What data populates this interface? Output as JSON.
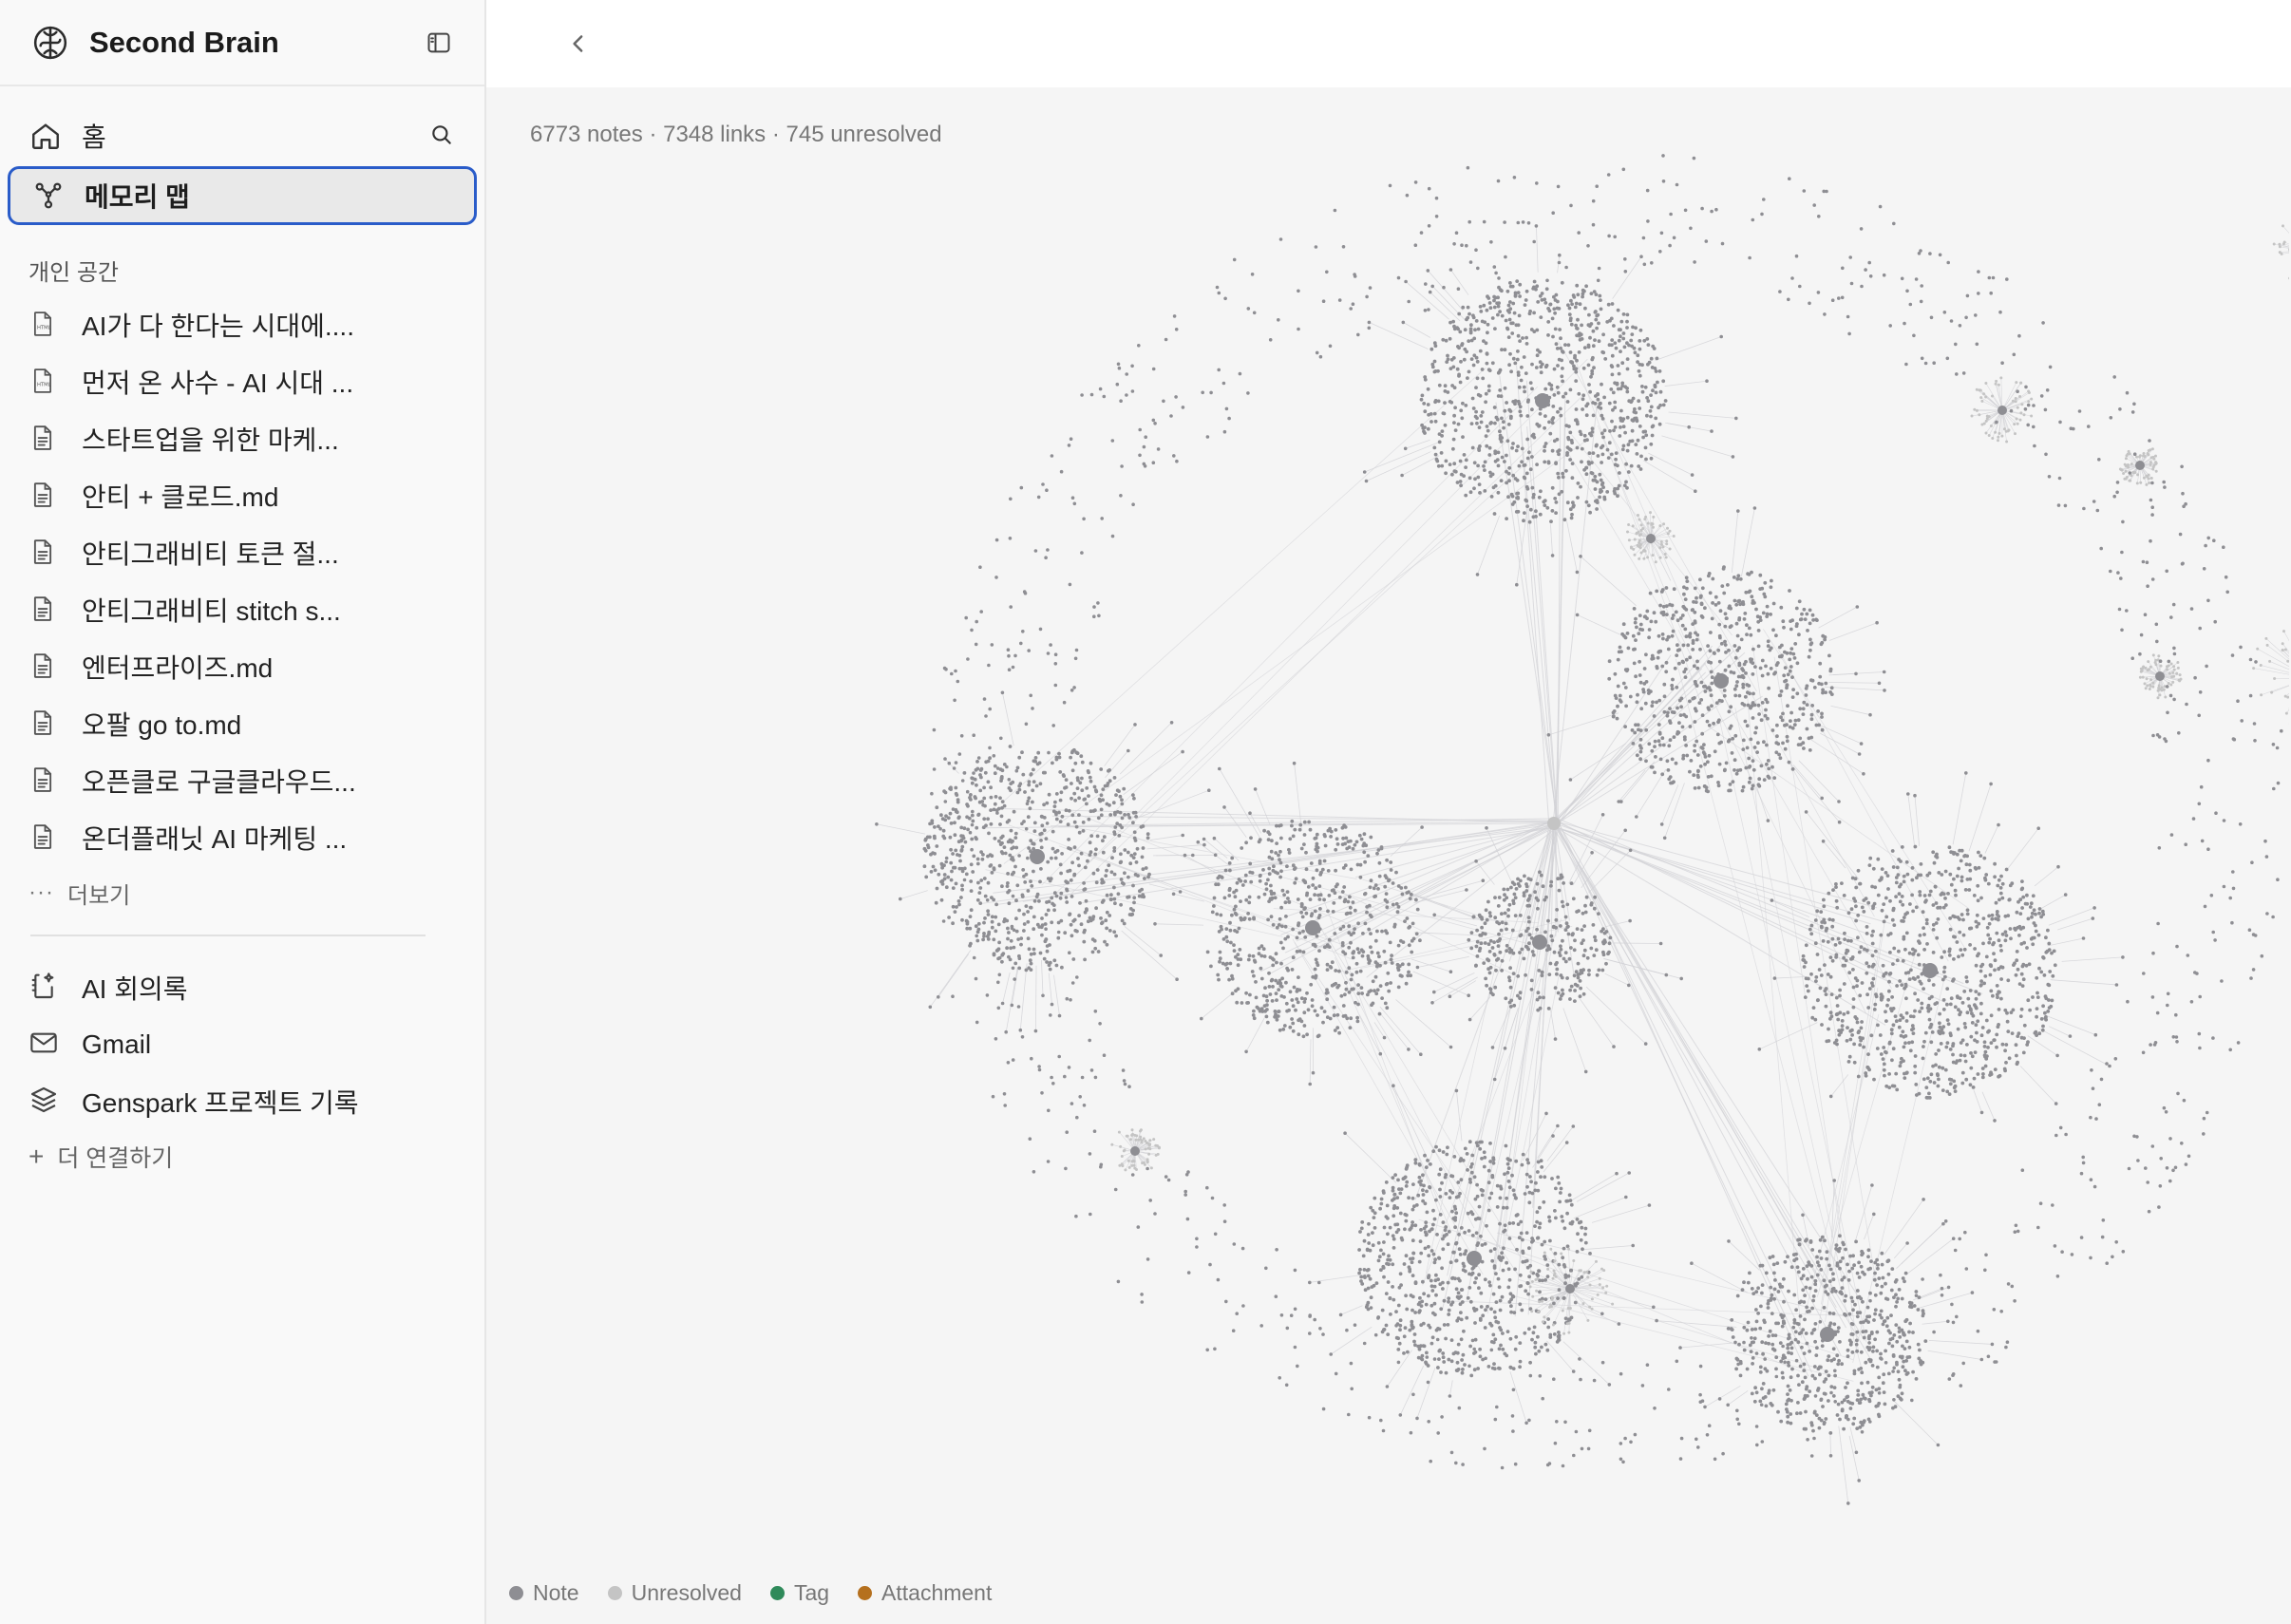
{
  "app": {
    "title": "Second Brain"
  },
  "nav": {
    "home_label": "홈",
    "memory_map_label": "메모리 맵"
  },
  "personal": {
    "section_label": "개인 공간",
    "files": [
      {
        "label": "AI가 다 한다는 시대에....",
        "icon": "html-file-icon"
      },
      {
        "label": "먼저 온 사수 - AI 시대 ...",
        "icon": "html-file-icon"
      },
      {
        "label": "스타트업을 위한 마케...",
        "icon": "document-icon"
      },
      {
        "label": "안티 + 클로드.md",
        "icon": "document-icon"
      },
      {
        "label": "안티그래비티 토큰 절...",
        "icon": "document-icon"
      },
      {
        "label": "안티그래비티 stitch s...",
        "icon": "document-icon"
      },
      {
        "label": "엔터프라이즈.md",
        "icon": "document-icon"
      },
      {
        "label": "오팔 go to.md",
        "icon": "document-icon"
      },
      {
        "label": "오픈클로 구글클라우드...",
        "icon": "document-icon"
      },
      {
        "label": "온더플래닛 AI 마케팅 ...",
        "icon": "document-icon"
      }
    ],
    "more_label": "더보기"
  },
  "integrations": {
    "items": [
      {
        "label": "AI 회의록",
        "icon": "ai-notes-icon"
      },
      {
        "label": "Gmail",
        "icon": "mail-icon"
      },
      {
        "label": "Genspark 프로젝트 기록",
        "icon": "layers-icon"
      }
    ],
    "connect_label": "더 연결하기"
  },
  "graph": {
    "stats": "6773 notes · 7348 links · 745 unresolved",
    "legend": [
      {
        "label": "Note",
        "color": "#8e8e93"
      },
      {
        "label": "Unresolved",
        "color": "#c4c4c4"
      },
      {
        "label": "Tag",
        "color": "#2f8a5a"
      },
      {
        "label": "Attachment",
        "color": "#b5701e"
      }
    ],
    "colors": {
      "node": "#8e8e93",
      "unresolved": "#c4c4c4",
      "edge": "#d2d2d6",
      "accent_border": "#2a5cc9"
    }
  }
}
